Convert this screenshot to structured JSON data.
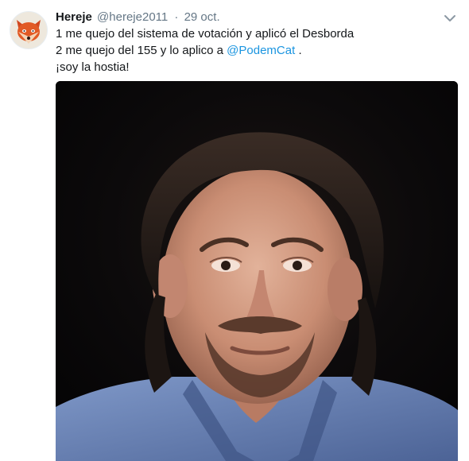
{
  "tweet": {
    "display_name": "Hereje",
    "username": "@hereje2011",
    "separator": "·",
    "timestamp": "29 oct.",
    "text": {
      "line1": "1 me quejo del sistema de votación y aplicó el Desborda",
      "line2_prefix": "2 me quejo del 155 y lo aplico a",
      "line2_mention": "@PodemCat",
      "line2_suffix": ".",
      "line3": "¡soy la hostia!"
    },
    "icons": {
      "avatar": "fox-avatar-icon",
      "menu": "chevron-down-icon"
    },
    "colors": {
      "link": "#1b95e0",
      "secondary_text": "#657786",
      "primary_text": "#14171a",
      "media_background": "#070608"
    }
  }
}
